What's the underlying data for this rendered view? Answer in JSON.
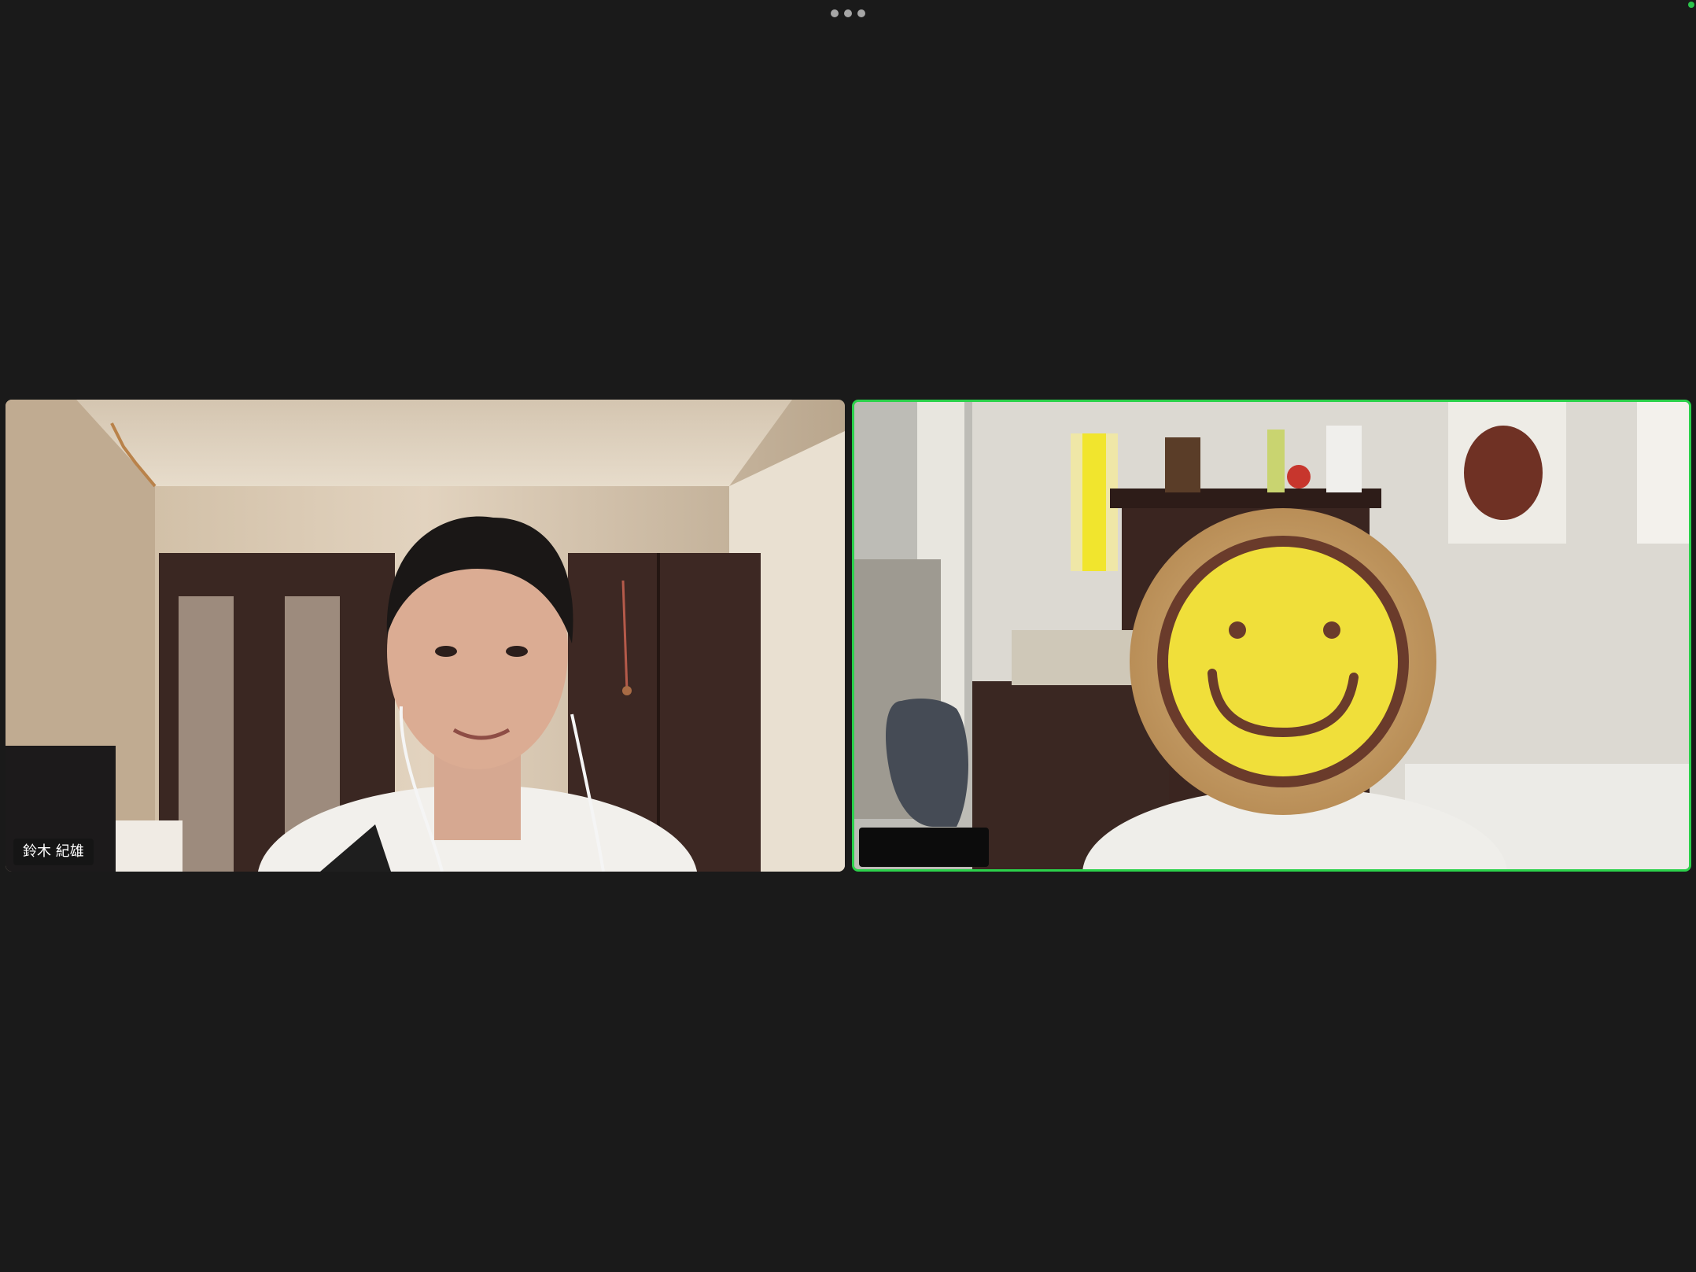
{
  "toolbar": {
    "more_icon": "more-horizontal-icon"
  },
  "participants": [
    {
      "name": "鈴木 紀雄",
      "active_speaker": false
    },
    {
      "name": "",
      "active_speaker": true,
      "face_cover": "smiley-face-sticker"
    }
  ],
  "colors": {
    "background": "#1a1a1a",
    "active_speaker_border": "#2bd14b",
    "status_indicator": "#2bc54b"
  }
}
